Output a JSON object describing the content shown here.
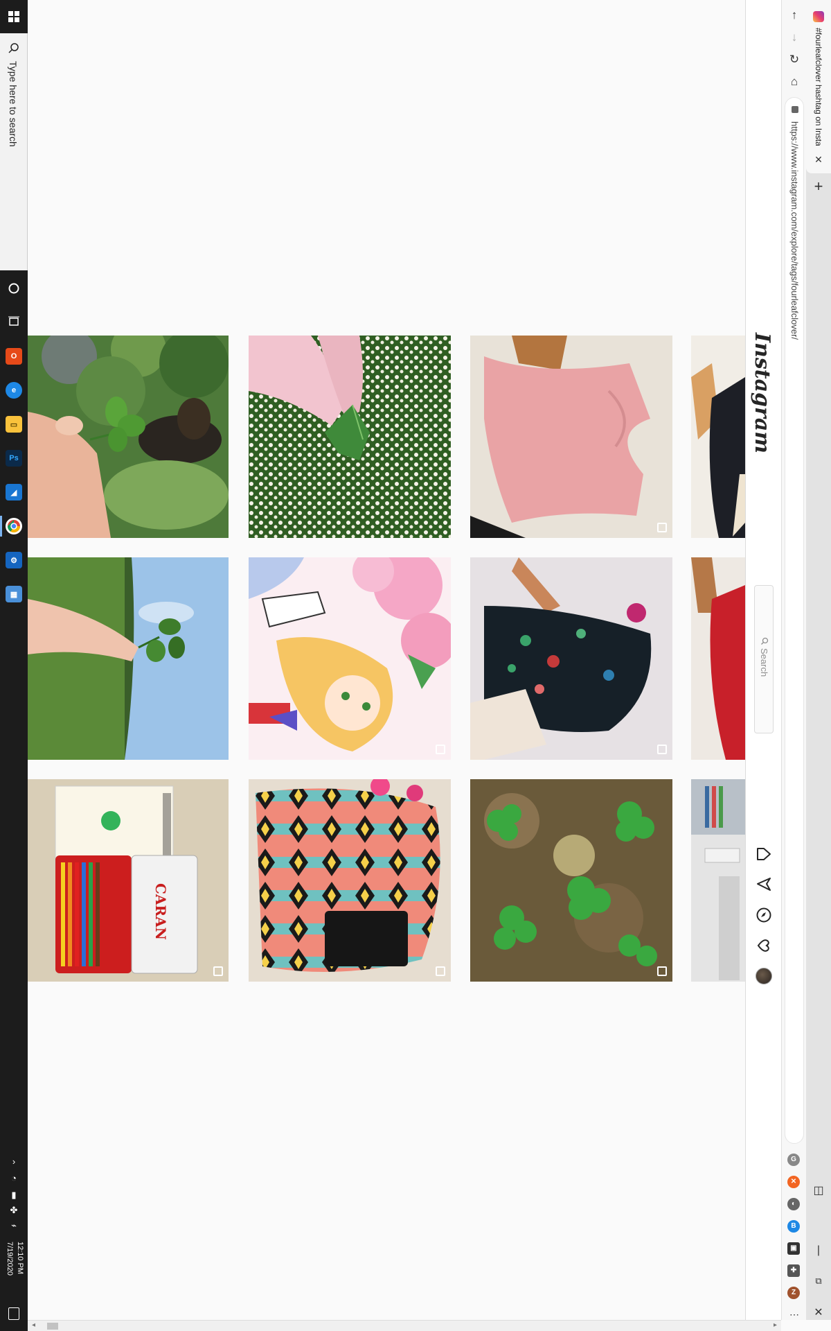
{
  "taskbar": {
    "search_placeholder": "Type here to search",
    "clock": {
      "time": "12:10 PM",
      "date": "7/19/2020"
    },
    "apps": [
      {
        "name": "cortana-icon",
        "glyph": "○",
        "color": "#1c1c1c"
      },
      {
        "name": "task-view-icon",
        "glyph": "⧉",
        "color": "#1c1c1c"
      },
      {
        "name": "office-icon",
        "glyph": "O",
        "color": "#e64a19"
      },
      {
        "name": "edge-icon",
        "glyph": "e",
        "color": "#1e88e5"
      },
      {
        "name": "file-explorer-icon",
        "glyph": "▭",
        "color": "#f9c23c"
      },
      {
        "name": "photoshop-icon",
        "glyph": "Ps",
        "color": "#0b2a4a"
      },
      {
        "name": "app-blue-icon",
        "glyph": "◢",
        "color": "#1976d2"
      },
      {
        "name": "chrome-icon",
        "glyph": "◉",
        "color": "#34a853"
      },
      {
        "name": "settings-app-icon",
        "glyph": "⚙",
        "color": "#1565c0"
      },
      {
        "name": "grid-app-icon",
        "glyph": "▦",
        "color": "#4a90d9"
      }
    ]
  },
  "browser": {
    "tab_title": "#fourleafclover hashtag on Insta",
    "url": "https://www.instagram.com/explore/tags/fourleafclover/",
    "colors": {
      "accent": "#3897f0"
    }
  },
  "instagram": {
    "logo": "Instagram",
    "search_placeholder": "Search",
    "nav_icons": [
      "home-icon",
      "direct-icon",
      "explore-icon",
      "activity-heart-icon",
      "avatar"
    ]
  },
  "posts": [
    {
      "name": "post-clover-dog",
      "multi": false
    },
    {
      "name": "post-clover-flowers",
      "multi": false
    },
    {
      "name": "post-pink-dress",
      "multi": true
    },
    {
      "name": "post-black-outfit",
      "multi": false
    },
    {
      "name": "post-clover-sky",
      "multi": false
    },
    {
      "name": "post-anime-girl",
      "multi": true
    },
    {
      "name": "post-floral-dress",
      "multi": true
    },
    {
      "name": "post-red-dress",
      "multi": false
    },
    {
      "name": "post-pencils-tin",
      "multi": true
    },
    {
      "name": "post-pattern-dress",
      "multi": true
    },
    {
      "name": "post-clover-forest",
      "multi": true
    },
    {
      "name": "post-desk",
      "multi": false
    }
  ]
}
